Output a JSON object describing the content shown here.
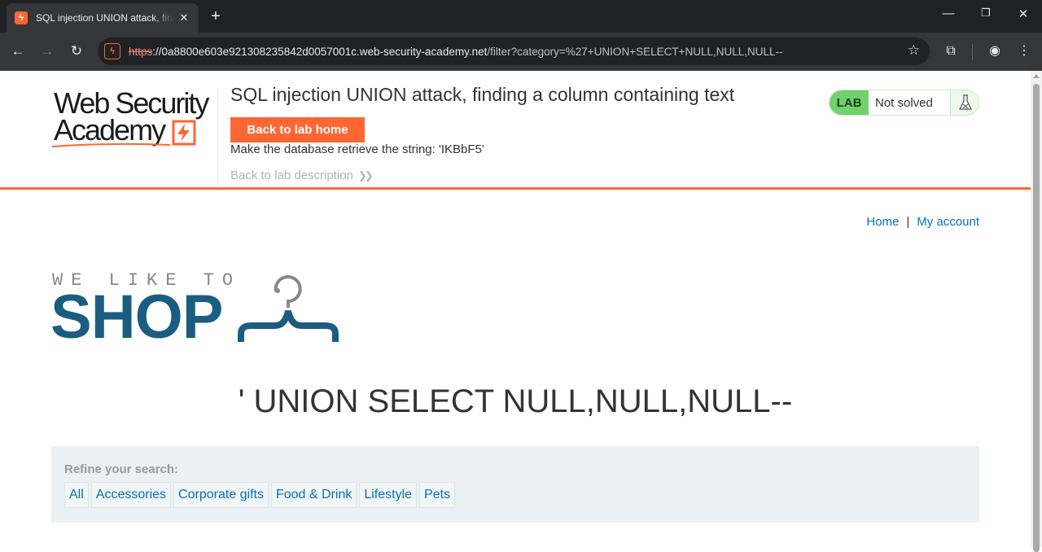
{
  "browser": {
    "tab_title": "SQL injection UNION attack, finding a column containing text",
    "tab_close_icon": "close-icon",
    "new_tab_icon": "plus-icon",
    "window_controls": [
      "minimize-icon",
      "restore-icon",
      "close-icon"
    ],
    "nav": [
      "back-arrow-icon",
      "forward-arrow-icon",
      "reload-icon"
    ],
    "url_proto": "https",
    "url_host": "://0a8800e603e921308235842d0057001c.web-security-academy.net",
    "url_path": "/filter?category=%27+UNION+SELECT+NULL,NULL,NULL--",
    "toolbar_icons": [
      "bookmark-star-icon",
      "cast-search-icon",
      "profile-icon",
      "menu-dots-icon"
    ]
  },
  "lab_header": {
    "logo_line1": "Web Security",
    "logo_line2": "Academy",
    "title": "SQL injection UNION attack, finding a column containing text",
    "back_button": "Back to lab home",
    "goal": "Make the database retrieve the string: 'IKBbF5'",
    "description_link": "Back to lab description",
    "status": {
      "badge": "LAB",
      "text": "Not solved",
      "icon": "flask-icon",
      "accent": "#70d16d"
    }
  },
  "nav": {
    "home": "Home",
    "separator": "|",
    "account": "My account"
  },
  "shop_logo": {
    "tagline": "WE LIKE TO",
    "name": "SHOP",
    "color": "#1b5d80"
  },
  "search_heading": "' UNION SELECT NULL,NULL,NULL--",
  "filters": {
    "label": "Refine your search:",
    "categories": [
      "All",
      "Accessories",
      "Corporate gifts",
      "Food & Drink",
      "Lifestyle",
      "Pets"
    ]
  },
  "colors": {
    "brand_orange": "#ff6633",
    "link_blue": "#0071bc"
  }
}
